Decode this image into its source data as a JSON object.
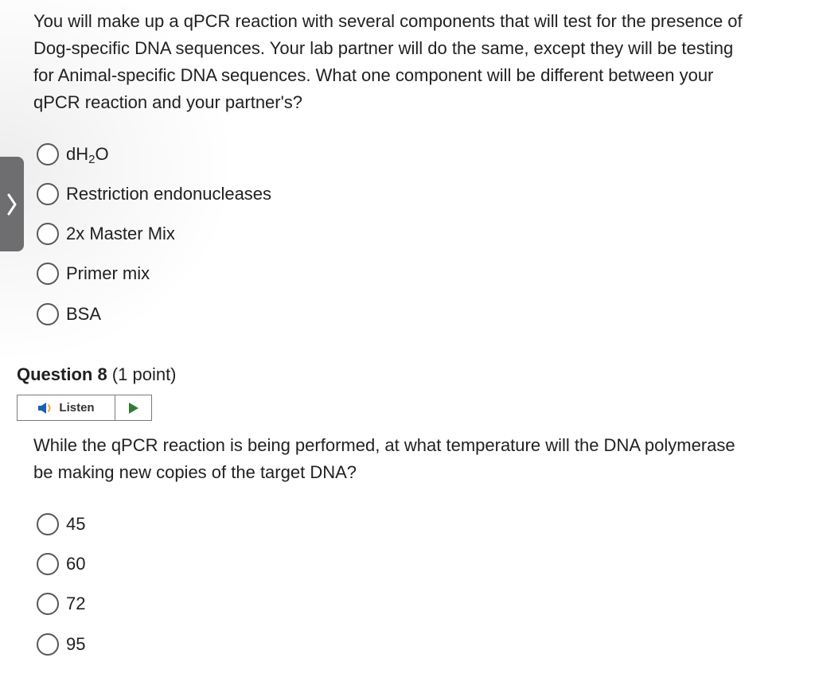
{
  "question7": {
    "text": "You will make up a qPCR reaction with several components that will test for the presence of Dog-specific DNA sequences. Your lab partner will do the same, except they will be testing for Animal-specific DNA sequences. What one component will be different between your qPCR reaction and your partner's?",
    "options": [
      {
        "label_main": "dH",
        "label_sub": "2",
        "label_tail": "O"
      },
      {
        "label": "Restriction endonucleases"
      },
      {
        "label": "2x Master Mix"
      },
      {
        "label": "Primer mix"
      },
      {
        "label": "BSA"
      }
    ]
  },
  "question8": {
    "heading_bold": "Question 8",
    "heading_points": " (1 point)",
    "listen_label": "Listen",
    "text": "While the qPCR reaction is being performed, at what temperature will the DNA polymerase be making new copies of the target DNA?",
    "options": [
      {
        "label": "45"
      },
      {
        "label": "60"
      },
      {
        "label": "72"
      },
      {
        "label": "95"
      }
    ]
  },
  "colors": {
    "listen_icon": "#1a5fb4",
    "play_icon": "#2e7d32",
    "side_tab": "#6e6e70"
  },
  "icons": [
    "chevron-right-icon",
    "speaker-icon",
    "play-icon",
    "radio-button"
  ]
}
